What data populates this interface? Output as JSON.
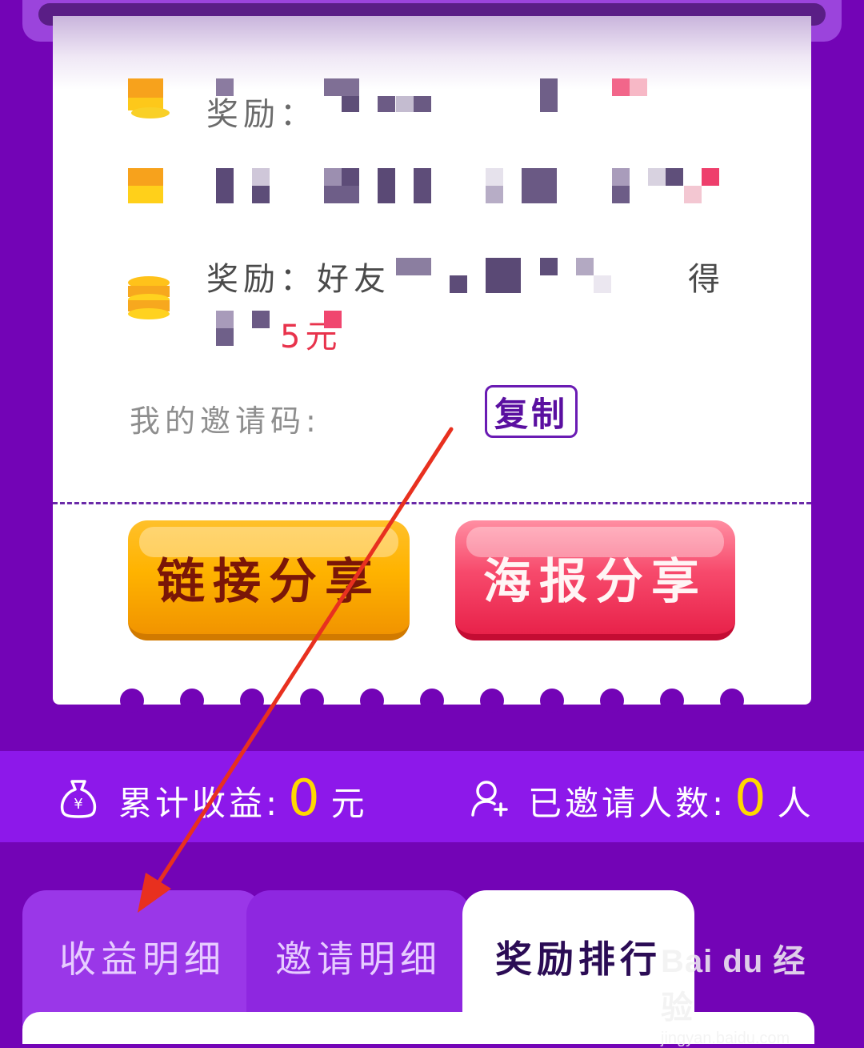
{
  "card": {
    "reward_rows": [
      {
        "text": "奖励："
      },
      {
        "text": ""
      },
      {
        "text": "奖励：好友",
        "suffix": "得",
        "line2_red": "5元"
      }
    ],
    "invite_label": "我的邀请码:",
    "copy_label": "复制",
    "share_link_label": "链接分享",
    "share_poster_label": "海报分享"
  },
  "stats": {
    "total_income_label": "累计收益:",
    "total_income_value": "0",
    "total_income_unit": "元",
    "invited_label": "已邀请人数:",
    "invited_value": "0",
    "invited_unit": "人"
  },
  "tabs": {
    "income": "收益明细",
    "invite": "邀请明细",
    "rank": "奖励排行"
  },
  "watermark": {
    "main": "Bai du 经验",
    "sub": "jingyan.baidu.com"
  },
  "colors": {
    "background": "#7304b6",
    "accent_yellow": "#ffd800",
    "annotation_arrow": "#e8301f"
  }
}
